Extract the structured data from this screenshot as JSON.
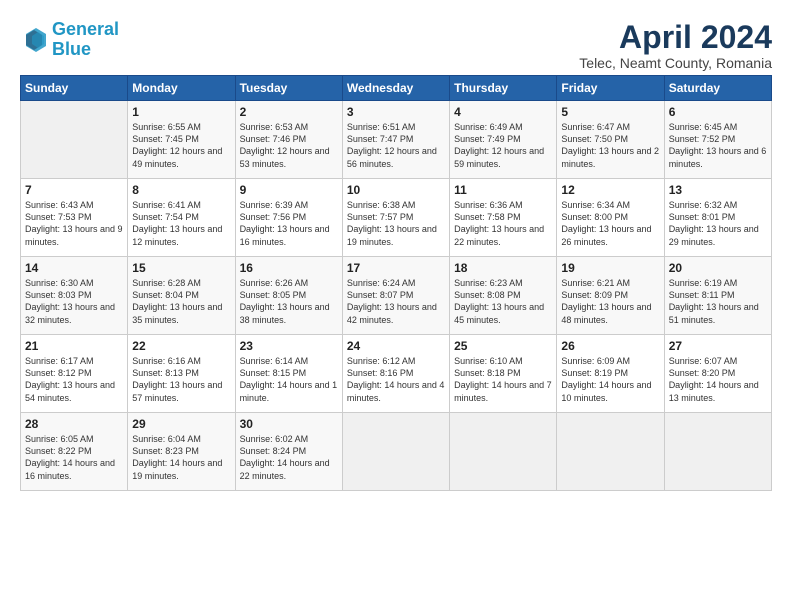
{
  "header": {
    "logo_line1": "General",
    "logo_line2": "Blue",
    "title": "April 2024",
    "subtitle": "Telec, Neamt County, Romania"
  },
  "weekdays": [
    "Sunday",
    "Monday",
    "Tuesday",
    "Wednesday",
    "Thursday",
    "Friday",
    "Saturday"
  ],
  "weeks": [
    [
      {
        "day": "",
        "sunrise": "",
        "sunset": "",
        "daylight": "",
        "empty": true
      },
      {
        "day": "1",
        "sunrise": "Sunrise: 6:55 AM",
        "sunset": "Sunset: 7:45 PM",
        "daylight": "Daylight: 12 hours and 49 minutes."
      },
      {
        "day": "2",
        "sunrise": "Sunrise: 6:53 AM",
        "sunset": "Sunset: 7:46 PM",
        "daylight": "Daylight: 12 hours and 53 minutes."
      },
      {
        "day": "3",
        "sunrise": "Sunrise: 6:51 AM",
        "sunset": "Sunset: 7:47 PM",
        "daylight": "Daylight: 12 hours and 56 minutes."
      },
      {
        "day": "4",
        "sunrise": "Sunrise: 6:49 AM",
        "sunset": "Sunset: 7:49 PM",
        "daylight": "Daylight: 12 hours and 59 minutes."
      },
      {
        "day": "5",
        "sunrise": "Sunrise: 6:47 AM",
        "sunset": "Sunset: 7:50 PM",
        "daylight": "Daylight: 13 hours and 2 minutes."
      },
      {
        "day": "6",
        "sunrise": "Sunrise: 6:45 AM",
        "sunset": "Sunset: 7:52 PM",
        "daylight": "Daylight: 13 hours and 6 minutes."
      }
    ],
    [
      {
        "day": "7",
        "sunrise": "Sunrise: 6:43 AM",
        "sunset": "Sunset: 7:53 PM",
        "daylight": "Daylight: 13 hours and 9 minutes."
      },
      {
        "day": "8",
        "sunrise": "Sunrise: 6:41 AM",
        "sunset": "Sunset: 7:54 PM",
        "daylight": "Daylight: 13 hours and 12 minutes."
      },
      {
        "day": "9",
        "sunrise": "Sunrise: 6:39 AM",
        "sunset": "Sunset: 7:56 PM",
        "daylight": "Daylight: 13 hours and 16 minutes."
      },
      {
        "day": "10",
        "sunrise": "Sunrise: 6:38 AM",
        "sunset": "Sunset: 7:57 PM",
        "daylight": "Daylight: 13 hours and 19 minutes."
      },
      {
        "day": "11",
        "sunrise": "Sunrise: 6:36 AM",
        "sunset": "Sunset: 7:58 PM",
        "daylight": "Daylight: 13 hours and 22 minutes."
      },
      {
        "day": "12",
        "sunrise": "Sunrise: 6:34 AM",
        "sunset": "Sunset: 8:00 PM",
        "daylight": "Daylight: 13 hours and 26 minutes."
      },
      {
        "day": "13",
        "sunrise": "Sunrise: 6:32 AM",
        "sunset": "Sunset: 8:01 PM",
        "daylight": "Daylight: 13 hours and 29 minutes."
      }
    ],
    [
      {
        "day": "14",
        "sunrise": "Sunrise: 6:30 AM",
        "sunset": "Sunset: 8:03 PM",
        "daylight": "Daylight: 13 hours and 32 minutes."
      },
      {
        "day": "15",
        "sunrise": "Sunrise: 6:28 AM",
        "sunset": "Sunset: 8:04 PM",
        "daylight": "Daylight: 13 hours and 35 minutes."
      },
      {
        "day": "16",
        "sunrise": "Sunrise: 6:26 AM",
        "sunset": "Sunset: 8:05 PM",
        "daylight": "Daylight: 13 hours and 38 minutes."
      },
      {
        "day": "17",
        "sunrise": "Sunrise: 6:24 AM",
        "sunset": "Sunset: 8:07 PM",
        "daylight": "Daylight: 13 hours and 42 minutes."
      },
      {
        "day": "18",
        "sunrise": "Sunrise: 6:23 AM",
        "sunset": "Sunset: 8:08 PM",
        "daylight": "Daylight: 13 hours and 45 minutes."
      },
      {
        "day": "19",
        "sunrise": "Sunrise: 6:21 AM",
        "sunset": "Sunset: 8:09 PM",
        "daylight": "Daylight: 13 hours and 48 minutes."
      },
      {
        "day": "20",
        "sunrise": "Sunrise: 6:19 AM",
        "sunset": "Sunset: 8:11 PM",
        "daylight": "Daylight: 13 hours and 51 minutes."
      }
    ],
    [
      {
        "day": "21",
        "sunrise": "Sunrise: 6:17 AM",
        "sunset": "Sunset: 8:12 PM",
        "daylight": "Daylight: 13 hours and 54 minutes."
      },
      {
        "day": "22",
        "sunrise": "Sunrise: 6:16 AM",
        "sunset": "Sunset: 8:13 PM",
        "daylight": "Daylight: 13 hours and 57 minutes."
      },
      {
        "day": "23",
        "sunrise": "Sunrise: 6:14 AM",
        "sunset": "Sunset: 8:15 PM",
        "daylight": "Daylight: 14 hours and 1 minute."
      },
      {
        "day": "24",
        "sunrise": "Sunrise: 6:12 AM",
        "sunset": "Sunset: 8:16 PM",
        "daylight": "Daylight: 14 hours and 4 minutes."
      },
      {
        "day": "25",
        "sunrise": "Sunrise: 6:10 AM",
        "sunset": "Sunset: 8:18 PM",
        "daylight": "Daylight: 14 hours and 7 minutes."
      },
      {
        "day": "26",
        "sunrise": "Sunrise: 6:09 AM",
        "sunset": "Sunset: 8:19 PM",
        "daylight": "Daylight: 14 hours and 10 minutes."
      },
      {
        "day": "27",
        "sunrise": "Sunrise: 6:07 AM",
        "sunset": "Sunset: 8:20 PM",
        "daylight": "Daylight: 14 hours and 13 minutes."
      }
    ],
    [
      {
        "day": "28",
        "sunrise": "Sunrise: 6:05 AM",
        "sunset": "Sunset: 8:22 PM",
        "daylight": "Daylight: 14 hours and 16 minutes."
      },
      {
        "day": "29",
        "sunrise": "Sunrise: 6:04 AM",
        "sunset": "Sunset: 8:23 PM",
        "daylight": "Daylight: 14 hours and 19 minutes."
      },
      {
        "day": "30",
        "sunrise": "Sunrise: 6:02 AM",
        "sunset": "Sunset: 8:24 PM",
        "daylight": "Daylight: 14 hours and 22 minutes."
      },
      {
        "day": "",
        "sunrise": "",
        "sunset": "",
        "daylight": "",
        "empty": true
      },
      {
        "day": "",
        "sunrise": "",
        "sunset": "",
        "daylight": "",
        "empty": true
      },
      {
        "day": "",
        "sunrise": "",
        "sunset": "",
        "daylight": "",
        "empty": true
      },
      {
        "day": "",
        "sunrise": "",
        "sunset": "",
        "daylight": "",
        "empty": true
      }
    ]
  ]
}
